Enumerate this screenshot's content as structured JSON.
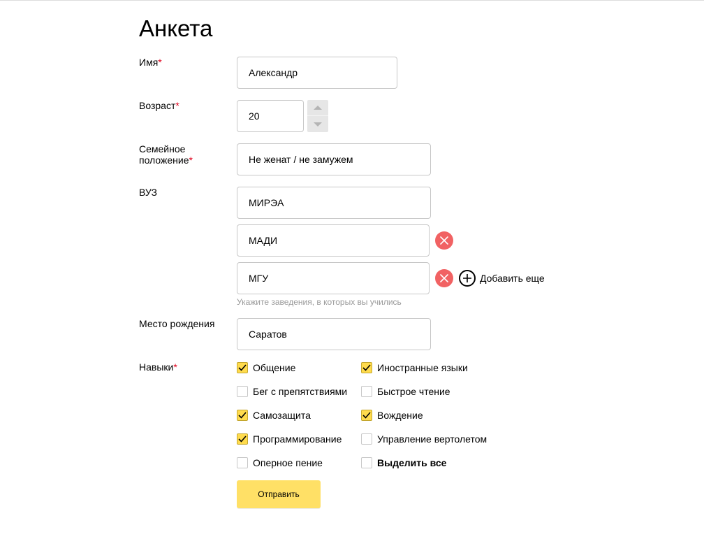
{
  "form": {
    "title": "Анкета",
    "required_mark": "*",
    "name": {
      "label": "Имя",
      "value": "Александр"
    },
    "age": {
      "label": "Возраст",
      "value": "20"
    },
    "marital": {
      "label_line1": "Семейное",
      "label_line2": "положение",
      "value": "Не женат / не замужем"
    },
    "university": {
      "label": "ВУЗ",
      "values": [
        "МИРЭА",
        "МАДИ",
        "МГУ"
      ],
      "add_label": "Добавить еще",
      "hint": "Укажите заведения, в которых вы учились"
    },
    "birthplace": {
      "label": "Место рождения",
      "value": "Саратов"
    },
    "skills": {
      "label": "Навыки",
      "items": [
        {
          "label": "Общение",
          "checked": true
        },
        {
          "label": "Иностранные языки",
          "checked": true
        },
        {
          "label": "Бег с препятствиями",
          "checked": false
        },
        {
          "label": "Быстрое чтение",
          "checked": false
        },
        {
          "label": "Самозащита",
          "checked": true
        },
        {
          "label": "Вождение",
          "checked": true
        },
        {
          "label": "Программирование",
          "checked": true
        },
        {
          "label": "Управление вертолетом",
          "checked": false
        },
        {
          "label": "Оперное пение",
          "checked": false
        },
        {
          "label": "Выделить все",
          "checked": false
        }
      ]
    },
    "submit_label": "Отправить"
  },
  "colors": {
    "accent": "#ffdb4d",
    "button": "#ffe066",
    "remove": "#f16263",
    "required": "#e0001b",
    "hint": "#999999"
  },
  "icons": [
    "chevron-up-icon",
    "chevron-down-icon",
    "close-icon",
    "plus-circle-icon",
    "checkmark-icon"
  ]
}
